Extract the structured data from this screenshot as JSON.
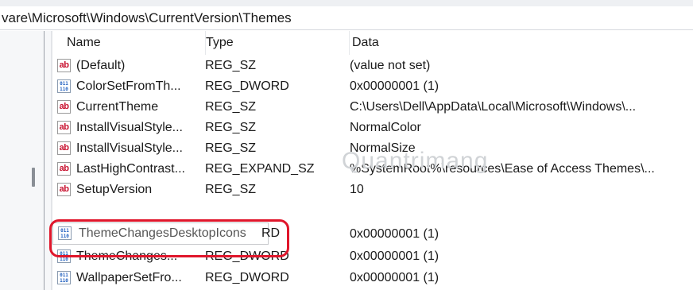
{
  "address_bar": {
    "path": "vare\\Microsoft\\Windows\\CurrentVersion\\Themes"
  },
  "columns": {
    "name": "Name",
    "type": "Type",
    "data": "Data"
  },
  "rows": [
    {
      "icon": "string-value-icon",
      "name": "(Default)",
      "type": "REG_SZ",
      "data": "(value not set)"
    },
    {
      "icon": "binary-value-icon",
      "name": "ColorSetFromTh...",
      "type": "REG_DWORD",
      "data": "0x00000001 (1)"
    },
    {
      "icon": "string-value-icon",
      "name": "CurrentTheme",
      "type": "REG_SZ",
      "data": "C:\\Users\\Dell\\AppData\\Local\\Microsoft\\Windows\\..."
    },
    {
      "icon": "string-value-icon",
      "name": "InstallVisualStyle...",
      "type": "REG_SZ",
      "data": "NormalColor"
    },
    {
      "icon": "string-value-icon",
      "name": "InstallVisualStyle...",
      "type": "REG_SZ",
      "data": "NormalSize"
    },
    {
      "icon": "string-value-icon",
      "name": "LastHighContrast...",
      "type": "REG_EXPAND_SZ",
      "data": "%SystemRoot%\\resources\\Ease of Access Themes\\..."
    },
    {
      "icon": "string-value-icon",
      "name": "SetupVersion",
      "type": "REG_SZ",
      "data": "10"
    },
    {
      "icon": "binary-value-icon",
      "name": "ThemeChangesDesktopIcons",
      "type": "RD",
      "data": "0x00000001 (1)",
      "editing": true
    },
    {
      "icon": "binary-value-icon",
      "name": "ThemeChanges...",
      "type": "REG_DWORD",
      "data": "0x00000001 (1)"
    },
    {
      "icon": "binary-value-icon",
      "name": "WallpaperSetFro...",
      "type": "REG_DWORD",
      "data": "0x00000001 (1)"
    }
  ],
  "icons": {
    "string": "ab",
    "binary_top": "011",
    "binary_bottom": "110"
  },
  "watermark": "Quantrimang",
  "colors": {
    "highlight": "#e0162b",
    "string_icon": "#c8102e",
    "binary_icon": "#1f5fbf"
  }
}
